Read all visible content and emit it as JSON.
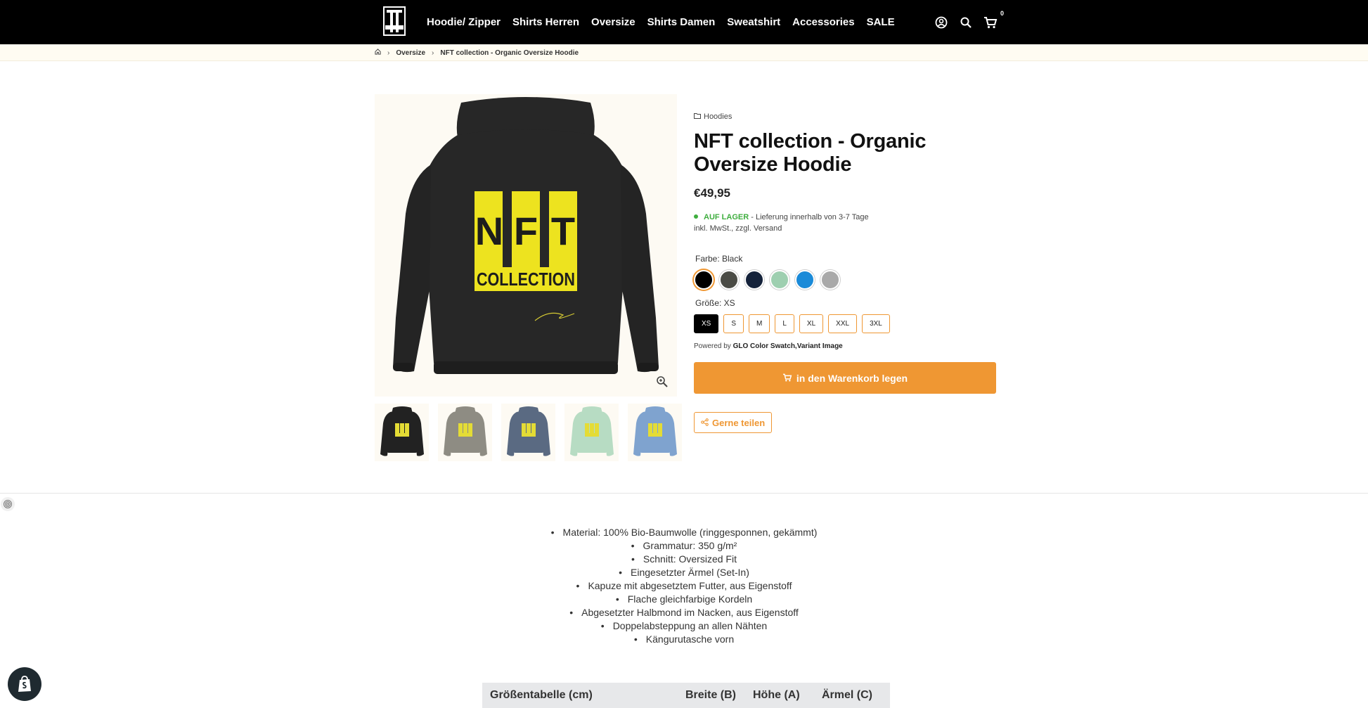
{
  "header": {
    "nav": [
      "Hoodie/ Zipper",
      "Shirts Herren",
      "Oversize",
      "Shirts Damen",
      "Sweatshirt",
      "Accessories",
      "SALE"
    ],
    "cart_count": "0",
    "icons": [
      "account-icon",
      "search-icon",
      "cart-icon"
    ]
  },
  "breadcrumb": {
    "items": [
      "Oversize",
      "NFT collection - Organic Oversize Hoodie"
    ]
  },
  "product": {
    "collection": "Hoodies",
    "title": "NFT collection - Organic Oversize Hoodie",
    "price": "€49,95",
    "stock_label": "AUF LAGER",
    "stock_text": " - Lieferung innerhalb von 3-7 Tage",
    "tax_text": "inkl. MwSt., zzgl. Versand",
    "color_label": "Farbe: Black",
    "colors": [
      "#000000",
      "#4a4b45",
      "#14223a",
      "#9ecfb0",
      "#1a8ad8",
      "#a9a9a9"
    ],
    "size_label": "Größe: XS",
    "sizes": [
      "XS",
      "S",
      "M",
      "L",
      "XL",
      "XXL",
      "3XL"
    ],
    "powered_prefix": "Powered by ",
    "powered_name": "GLO Color Swatch,Variant Image",
    "add_to_cart": "in den Warenkorb legen",
    "share": "Gerne teilen",
    "thumb_colors": [
      "#222222",
      "#8e8c83",
      "#5a6a82",
      "#b7dcc3",
      "#7fa3cf"
    ]
  },
  "image_text": {
    "big": "NFT",
    "small": "COLLECTION"
  },
  "description": [
    "Material: 100% Bio-Baumwolle (ringgesponnen, gekämmt)",
    "Grammatur: 350 g/m²",
    "Schnitt: Oversized Fit",
    "Eingesetzter Ärmel (Set-In)",
    "Kapuze mit abgesetztem Futter, aus Eigenstoff",
    "Flache gleichfarbige Kordeln",
    "Abgesetzter Halbmond im Nacken, aus Eigenstoff",
    "Doppelabsteppung an allen Nähten",
    "Kängurutasche vorn"
  ],
  "size_table": {
    "headers": [
      "Größentabelle (cm)",
      "Breite (B)",
      "Höhe (A)",
      "Ärmel (C)"
    ]
  }
}
